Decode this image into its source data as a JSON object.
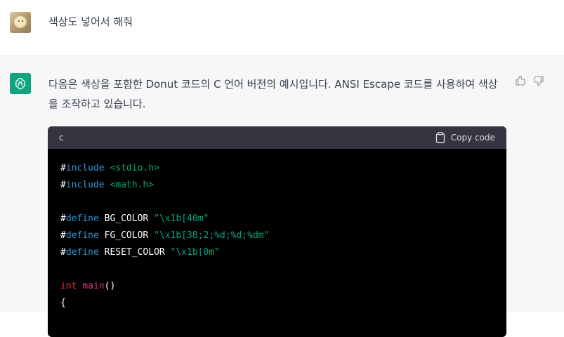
{
  "user_message": {
    "text": "색상도 넣어서 해줘"
  },
  "assistant_message": {
    "text": "다음은 색상을 포함한 Donut 코드의 C 언어 버전의 예시입니다. ANSI Escape 코드를 사용하여 색상을 조작하고 있습니다."
  },
  "code_block": {
    "language": "c",
    "copy_label": "Copy code",
    "lines": {
      "l1": {
        "hash": "#",
        "directive": "include",
        "arg": " <stdio.h>"
      },
      "l2": {
        "hash": "#",
        "directive": "include",
        "arg": " <math.h>"
      },
      "l4": {
        "hash": "#",
        "directive": "define",
        "name": " BG_COLOR ",
        "value": "\"\\x1b[40m\""
      },
      "l5": {
        "hash": "#",
        "directive": "define",
        "name": " FG_COLOR ",
        "value": "\"\\x1b[38;2;%d;%d;%dm\""
      },
      "l6": {
        "hash": "#",
        "directive": "define",
        "name": " RESET_COLOR ",
        "value": "\"\\x1b[0m\""
      },
      "l8": {
        "type": "int",
        "fn": " main",
        "rest": "()"
      },
      "l9": {
        "text": "{"
      }
    }
  },
  "colors": {
    "accent": "#10a37f",
    "code_bg": "#000000",
    "code_header_bg": "#343541",
    "keyword": "#2e95d3",
    "string": "#00a67d",
    "type": "#f22c3d"
  },
  "icons": [
    "chatgpt-logo-icon",
    "thumbs-up-icon",
    "thumbs-down-icon",
    "clipboard-icon"
  ]
}
